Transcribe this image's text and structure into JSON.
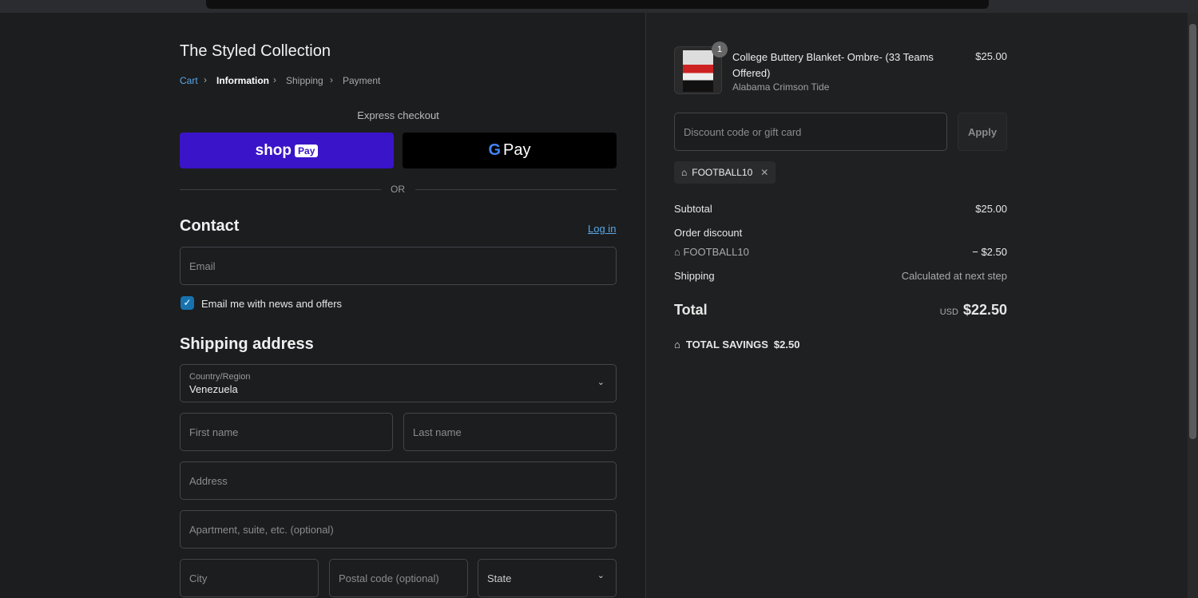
{
  "store": {
    "title": "The Styled Collection"
  },
  "breadcrumb": [
    "Cart",
    "Information",
    "Shipping",
    "Payment"
  ],
  "express": {
    "label": "Express checkout",
    "shop_pay": "shop",
    "shop_pay_badge": "Pay",
    "gpay": "Pay",
    "or": "OR"
  },
  "contact": {
    "heading": "Contact",
    "login": "Log in",
    "email_placeholder": "Email",
    "newsletter": "Email me with news and offers",
    "newsletter_checked": true
  },
  "shipping": {
    "heading": "Shipping address",
    "country_label": "Country/Region",
    "country_value": "Venezuela",
    "first_name": "First name",
    "last_name": "Last name",
    "address": "Address",
    "apartment": "Apartment, suite, etc. (optional)",
    "city": "City",
    "postal": "Postal code (optional)",
    "state": "State"
  },
  "summary": {
    "item": {
      "name": "College Buttery Blanket- Ombre- (33 Teams Offered)",
      "variant": "Alabama Crimson Tide",
      "price": "$25.00",
      "quantity": "1"
    },
    "discount_placeholder": "Discount code or gift card",
    "apply": "Apply",
    "applied_code": "FOOTBALL10",
    "subtotal_label": "Subtotal",
    "subtotal": "$25.00",
    "order_discount_label": "Order discount",
    "discount_code": "FOOTBALL10",
    "discount_amount": "− $2.50",
    "shipping_label": "Shipping",
    "shipping_value": "Calculated at next step",
    "total_label": "Total",
    "currency": "USD",
    "total": "$22.50",
    "savings_label": "TOTAL SAVINGS",
    "savings": "$2.50"
  }
}
